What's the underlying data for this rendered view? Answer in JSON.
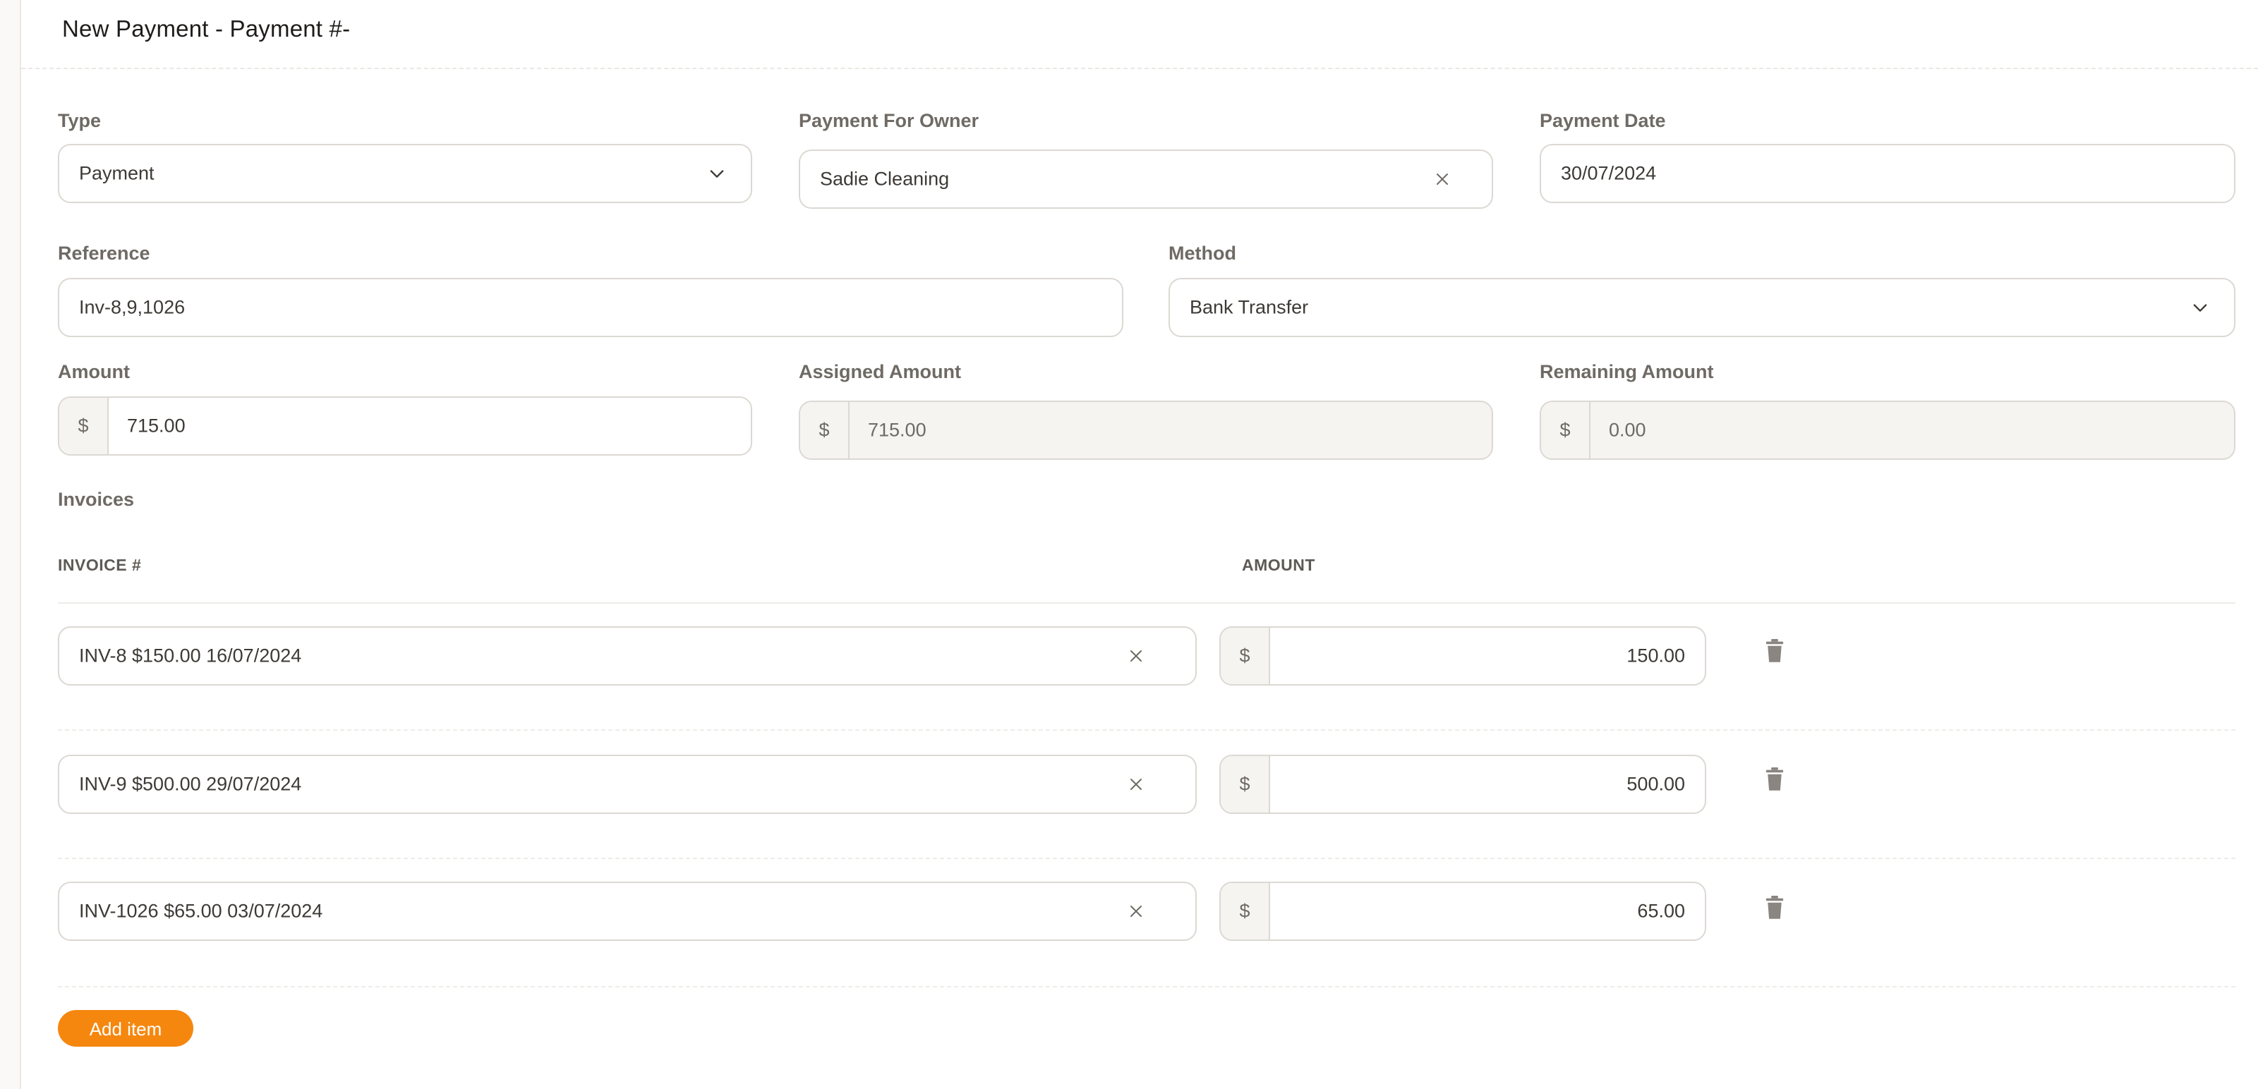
{
  "header": {
    "title": "New Payment - Payment #-"
  },
  "form": {
    "type": {
      "label": "Type",
      "value": "Payment"
    },
    "owner": {
      "label": "Payment For Owner",
      "value": "Sadie Cleaning"
    },
    "payment_date": {
      "label": "Payment Date",
      "value": "30/07/2024"
    },
    "reference": {
      "label": "Reference",
      "value": "Inv-8,9,1026"
    },
    "method": {
      "label": "Method",
      "value": "Bank Transfer"
    },
    "amount": {
      "label": "Amount",
      "currency": "$",
      "value": "715.00"
    },
    "assigned_amount": {
      "label": "Assigned Amount",
      "currency": "$",
      "value": "715.00"
    },
    "remaining_amount": {
      "label": "Remaining Amount",
      "currency": "$",
      "value": "0.00"
    }
  },
  "invoices": {
    "title": "Invoices",
    "columns": {
      "invoice": "INVOICE #",
      "amount": "AMOUNT"
    },
    "rows": [
      {
        "invoice": "INV-8 $150.00 16/07/2024",
        "currency": "$",
        "amount": "150.00"
      },
      {
        "invoice": "INV-9 $500.00 29/07/2024",
        "currency": "$",
        "amount": "500.00"
      },
      {
        "invoice": "INV-1026 $65.00 03/07/2024",
        "currency": "$",
        "amount": "65.00"
      }
    ],
    "add_button": "Add item"
  },
  "colors": {
    "accent": "#f5870f",
    "border": "#dcd8d3",
    "disabled_bg": "#f5f4f1",
    "label": "#6f6a64"
  },
  "icons": {
    "select": "chevron-down-icon",
    "clear": "close-icon",
    "delete": "trash-icon"
  }
}
